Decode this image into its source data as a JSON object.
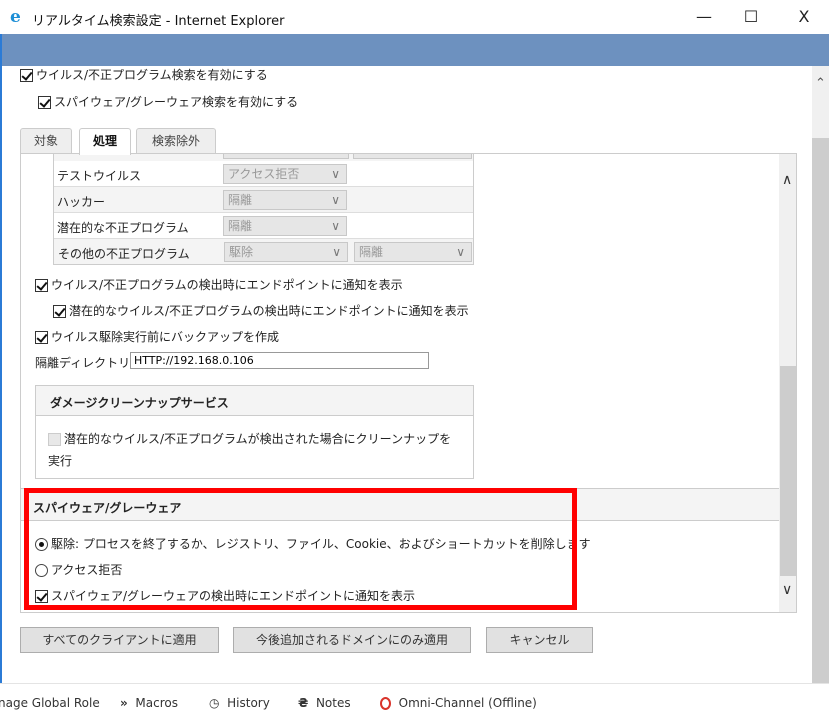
{
  "window": {
    "title": "リアルタイム検索設定 - Internet Explorer",
    "minimize": "—",
    "maximize": "☐",
    "close": "X"
  },
  "top_checks": [
    {
      "label": "ウイルス/不正プログラム検索を有効にする",
      "checked": true
    },
    {
      "label": "スパイウェア/グレーウェア検索を有効にする",
      "checked": true
    }
  ],
  "tabs": [
    {
      "label": "対象"
    },
    {
      "label": "処理",
      "active": true
    },
    {
      "label": "検索除外"
    }
  ],
  "actions_table": [
    {
      "label": "テストウイルス",
      "action1": "アクセス拒否",
      "action2": ""
    },
    {
      "label": "ハッカー",
      "action1": "隔離",
      "action2": ""
    },
    {
      "label": "潜在的な不正プログラム",
      "action1": "隔離",
      "action2": ""
    },
    {
      "label": "その他の不正プログラム",
      "action1": "駆除",
      "action2": "隔離"
    }
  ],
  "options": [
    {
      "label": "ウイルス/不正プログラムの検出時にエンドポイントに通知を表示",
      "checked": true
    },
    {
      "label": "潜在的なウイルス/不正プログラムの検出時にエンドポイントに通知を表示",
      "checked": true
    },
    {
      "label": "ウイルス駆除実行前にバックアップを作成",
      "checked": true
    }
  ],
  "quarantine": {
    "label": "隔離ディレクトリ:",
    "value": "HTTP://192.168.0.106"
  },
  "damage_cleanup": {
    "title": "ダメージクリーンナップサービス",
    "option": "潜在的なウイルス/不正プログラムが検出された場合にクリーンナップを実行",
    "checked": false,
    "disabled": true
  },
  "spyware": {
    "title": "スパイウェア/グレーウェア",
    "radio_clean": "駆除: プロセスを終了するか、レジストリ、ファイル、Cookie、およびショートカットを削除します",
    "radio_deny": "アクセス拒否",
    "selected": "clean",
    "notify": "スパイウェア/グレーウェアの検出時にエンドポイントに通知を表示",
    "notify_checked": true,
    "highlight_color": "#ff0000"
  },
  "buttons": {
    "apply_all": "すべてのクライアントに適用",
    "apply_future": "今後追加されるドメインにのみ適用",
    "cancel": "キャンセル"
  },
  "bottom_bar": [
    {
      "label": "nage Global Role",
      "icon": ""
    },
    {
      "label": "Macros",
      "icon": "chevrons-icon"
    },
    {
      "label": "History",
      "icon": "clock-icon"
    },
    {
      "label": "Notes",
      "icon": "notes-icon"
    },
    {
      "label": "Omni-Channel (Offline)",
      "icon": "offline-circle-icon"
    }
  ],
  "colors": {
    "band": "#6d91bf",
    "red": "#ff0000"
  }
}
